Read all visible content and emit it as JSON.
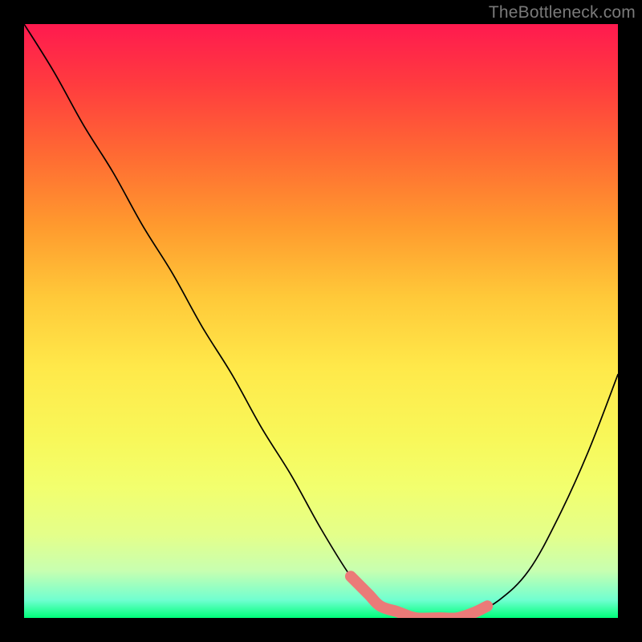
{
  "watermark": "TheBottleneck.com",
  "chart_data": {
    "type": "line",
    "title": "",
    "xlabel": "",
    "ylabel": "",
    "xlim": [
      0,
      100
    ],
    "ylim": [
      0,
      100
    ],
    "series": [
      {
        "name": "curve",
        "x": [
          0,
          5,
          10,
          15,
          20,
          25,
          30,
          35,
          40,
          45,
          50,
          55,
          58,
          60,
          63,
          66,
          70,
          73,
          76,
          80,
          85,
          90,
          95,
          100
        ],
        "values": [
          100,
          92,
          83,
          75,
          66,
          58,
          49,
          41,
          32,
          24,
          15,
          7,
          4,
          2,
          1,
          0,
          0,
          0,
          1,
          3,
          8,
          17,
          28,
          41
        ]
      },
      {
        "name": "highlight-band",
        "x": [
          55,
          58,
          60,
          63,
          66,
          70,
          73,
          76,
          78
        ],
        "values": [
          7,
          4,
          2,
          1,
          0,
          0,
          0,
          1,
          2
        ]
      }
    ],
    "annotations": []
  },
  "colors": {
    "curve": "#000000",
    "highlight": "#eb7a78",
    "background_top": "#ff1a4f",
    "background_bottom": "#00ff7a"
  }
}
